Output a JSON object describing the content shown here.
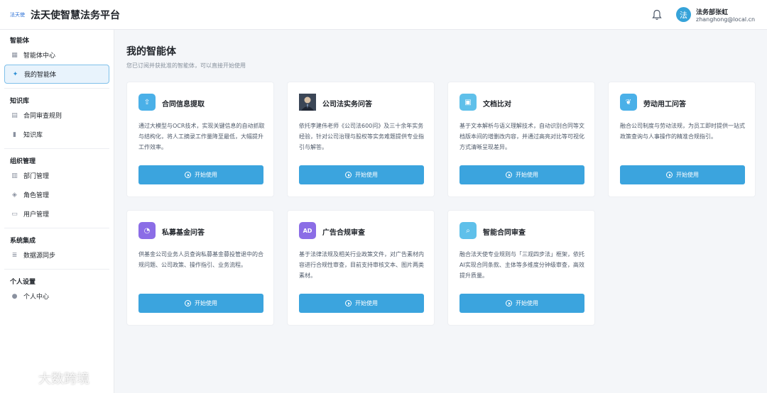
{
  "header": {
    "logo_text": "法天使",
    "app_title": "法天使智慧法务平台",
    "user_name": "法务部张虹",
    "user_email": "zhanghong@local.cn",
    "avatar_text": "法"
  },
  "sidebar": {
    "groups": [
      {
        "title": "智能体",
        "items": [
          {
            "label": "智能体中心",
            "icon": "grid-icon"
          },
          {
            "label": "我的智能体",
            "icon": "sparkle-icon",
            "active": true
          }
        ]
      },
      {
        "title": "知识库",
        "items": [
          {
            "label": "合同审查规则",
            "icon": "file-icon"
          },
          {
            "label": "知识库",
            "icon": "book-icon"
          }
        ]
      },
      {
        "title": "组织管理",
        "items": [
          {
            "label": "部门管理",
            "icon": "org-icon"
          },
          {
            "label": "角色管理",
            "icon": "shield-icon"
          },
          {
            "label": "用户管理",
            "icon": "user-card-icon"
          }
        ]
      },
      {
        "title": "系统集成",
        "items": [
          {
            "label": "数据源同步",
            "icon": "database-icon"
          }
        ]
      },
      {
        "title": "个人设置",
        "items": [
          {
            "label": "个人中心",
            "icon": "user-icon"
          }
        ]
      }
    ]
  },
  "main": {
    "title": "我的智能体",
    "subtitle": "您已订阅并获批准的智能体，可以直接开始使用",
    "button_label": "开始使用",
    "cards": [
      {
        "title": "合同信息提取",
        "icon": "upload-doc-icon",
        "desc": "通过大模型与OCR技术，实现关键信息的自动抓取与结构化，将人工摘录工作量降至最低，大幅提升工作效率。"
      },
      {
        "title": "公司法实务问答",
        "icon": "lawyer-avatar",
        "desc": "依托李建伟老师《公司法600问》及三十余年实务经验，针对公司治理与股权等实务难题提供专业指引与解答。"
      },
      {
        "title": "文档比对",
        "icon": "compare-doc-icon",
        "desc": "基于文本解析与语义理解技术，自动识别合同等文档版本间的增删改内容，并通过高亮对比等可视化方式清晰呈现差异。"
      },
      {
        "title": "劳动用工问答",
        "icon": "leaf-icon",
        "desc": "融合公司制度与劳动法规，为员工即时提供一站式政策查询与人事操作的精准合规指引。"
      },
      {
        "title": "私募基金问答",
        "icon": "chat-bubble-icon",
        "desc": "供基金公司业务人员查询私募基金募投管退中的合规问题、公司政策、操作指引、业务流程。"
      },
      {
        "title": "广告合规审查",
        "icon": "ad-icon",
        "desc": "基于法律法规及相关行业政策文件，对广告素材内容进行合规性审查，目前支持审核文本、图片两类素材。"
      },
      {
        "title": "智能合同审查",
        "icon": "search-doc-icon",
        "desc": "融合法天使专业规则与「三观四步法」框架，依托AI实现合同条款、主体等多维度分钟级审查，高效提升质量。"
      }
    ]
  },
  "watermark": {
    "text": "大数跨境"
  },
  "colors": {
    "accent": "#3ba4de",
    "active_bg": "#e8f3fc",
    "page_bg": "#f4f6f9"
  }
}
